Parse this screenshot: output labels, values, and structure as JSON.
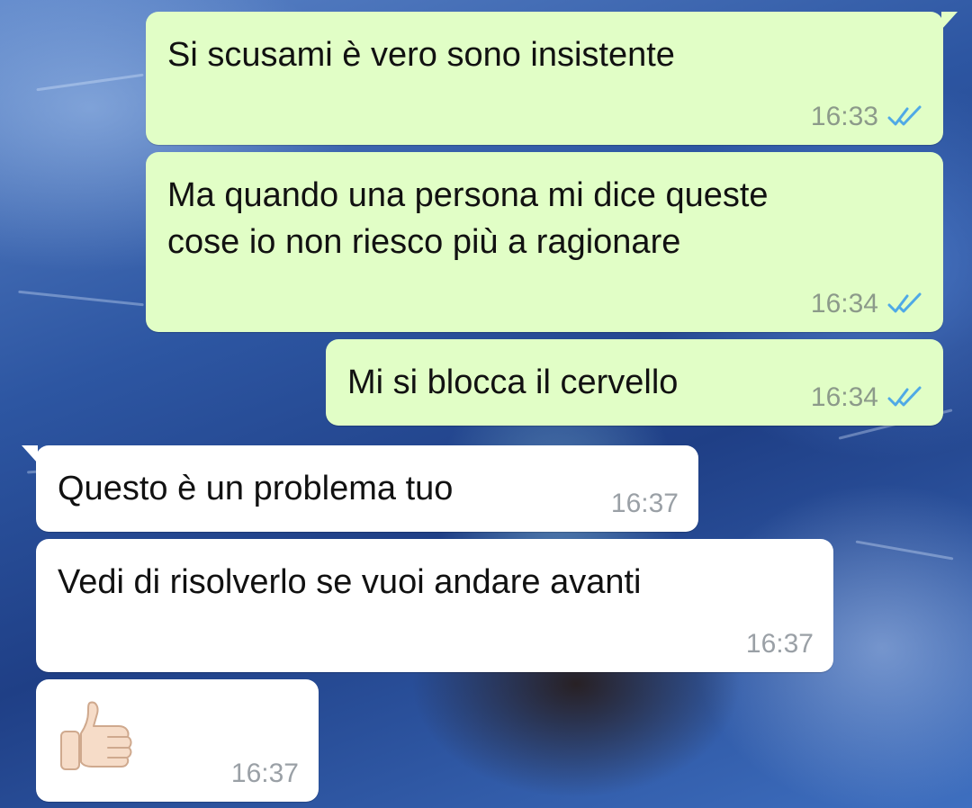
{
  "colors": {
    "outgoing_bubble": "#e1fec6",
    "incoming_bubble": "#ffffff",
    "read_ticks": "#4fa9e6"
  },
  "messages": [
    {
      "direction": "outgoing",
      "text": "Si scusami è vero sono insistente",
      "time": "16:33",
      "status_icon": "double-check-read-icon"
    },
    {
      "direction": "outgoing",
      "text": "Ma quando una persona mi dice queste\ncose io non riesco più a ragionare",
      "time": "16:34",
      "status_icon": "double-check-read-icon"
    },
    {
      "direction": "outgoing",
      "text": "Mi si blocca il cervello",
      "time": "16:34",
      "status_icon": "double-check-read-icon"
    },
    {
      "direction": "incoming",
      "text": "Questo è un problema tuo",
      "time": "16:37"
    },
    {
      "direction": "incoming",
      "text": "Vedi di risolverlo se vuoi andare avanti",
      "time": "16:37"
    },
    {
      "direction": "incoming",
      "text": "",
      "emoji": "thumbs-up-icon",
      "time": "16:37"
    }
  ]
}
